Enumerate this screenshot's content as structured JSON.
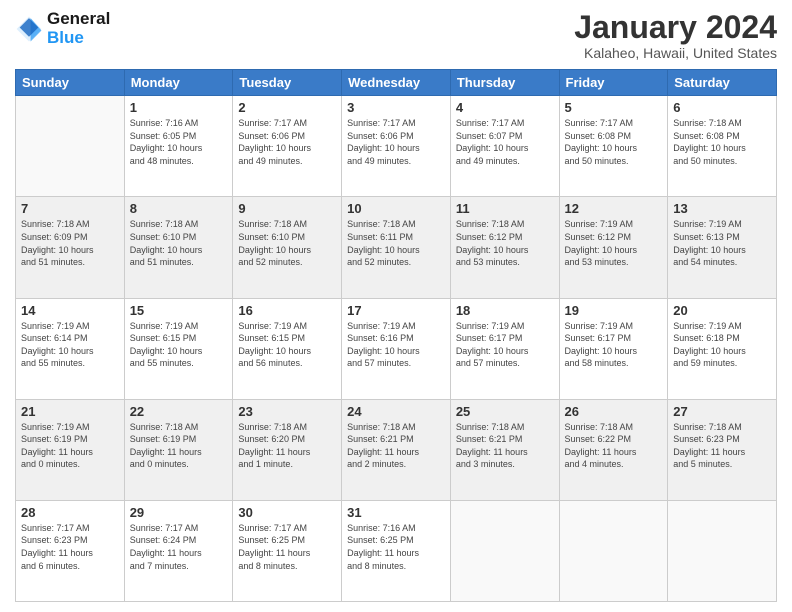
{
  "logo": {
    "line1": "General",
    "line2": "Blue"
  },
  "header": {
    "month": "January 2024",
    "location": "Kalaheo, Hawaii, United States"
  },
  "weekdays": [
    "Sunday",
    "Monday",
    "Tuesday",
    "Wednesday",
    "Thursday",
    "Friday",
    "Saturday"
  ],
  "weeks": [
    [
      {
        "day": "",
        "info": ""
      },
      {
        "day": "1",
        "info": "Sunrise: 7:16 AM\nSunset: 6:05 PM\nDaylight: 10 hours\nand 48 minutes."
      },
      {
        "day": "2",
        "info": "Sunrise: 7:17 AM\nSunset: 6:06 PM\nDaylight: 10 hours\nand 49 minutes."
      },
      {
        "day": "3",
        "info": "Sunrise: 7:17 AM\nSunset: 6:06 PM\nDaylight: 10 hours\nand 49 minutes."
      },
      {
        "day": "4",
        "info": "Sunrise: 7:17 AM\nSunset: 6:07 PM\nDaylight: 10 hours\nand 49 minutes."
      },
      {
        "day": "5",
        "info": "Sunrise: 7:17 AM\nSunset: 6:08 PM\nDaylight: 10 hours\nand 50 minutes."
      },
      {
        "day": "6",
        "info": "Sunrise: 7:18 AM\nSunset: 6:08 PM\nDaylight: 10 hours\nand 50 minutes."
      }
    ],
    [
      {
        "day": "7",
        "info": "Sunrise: 7:18 AM\nSunset: 6:09 PM\nDaylight: 10 hours\nand 51 minutes."
      },
      {
        "day": "8",
        "info": "Sunrise: 7:18 AM\nSunset: 6:10 PM\nDaylight: 10 hours\nand 51 minutes."
      },
      {
        "day": "9",
        "info": "Sunrise: 7:18 AM\nSunset: 6:10 PM\nDaylight: 10 hours\nand 52 minutes."
      },
      {
        "day": "10",
        "info": "Sunrise: 7:18 AM\nSunset: 6:11 PM\nDaylight: 10 hours\nand 52 minutes."
      },
      {
        "day": "11",
        "info": "Sunrise: 7:18 AM\nSunset: 6:12 PM\nDaylight: 10 hours\nand 53 minutes."
      },
      {
        "day": "12",
        "info": "Sunrise: 7:19 AM\nSunset: 6:12 PM\nDaylight: 10 hours\nand 53 minutes."
      },
      {
        "day": "13",
        "info": "Sunrise: 7:19 AM\nSunset: 6:13 PM\nDaylight: 10 hours\nand 54 minutes."
      }
    ],
    [
      {
        "day": "14",
        "info": "Sunrise: 7:19 AM\nSunset: 6:14 PM\nDaylight: 10 hours\nand 55 minutes."
      },
      {
        "day": "15",
        "info": "Sunrise: 7:19 AM\nSunset: 6:15 PM\nDaylight: 10 hours\nand 55 minutes."
      },
      {
        "day": "16",
        "info": "Sunrise: 7:19 AM\nSunset: 6:15 PM\nDaylight: 10 hours\nand 56 minutes."
      },
      {
        "day": "17",
        "info": "Sunrise: 7:19 AM\nSunset: 6:16 PM\nDaylight: 10 hours\nand 57 minutes."
      },
      {
        "day": "18",
        "info": "Sunrise: 7:19 AM\nSunset: 6:17 PM\nDaylight: 10 hours\nand 57 minutes."
      },
      {
        "day": "19",
        "info": "Sunrise: 7:19 AM\nSunset: 6:17 PM\nDaylight: 10 hours\nand 58 minutes."
      },
      {
        "day": "20",
        "info": "Sunrise: 7:19 AM\nSunset: 6:18 PM\nDaylight: 10 hours\nand 59 minutes."
      }
    ],
    [
      {
        "day": "21",
        "info": "Sunrise: 7:19 AM\nSunset: 6:19 PM\nDaylight: 11 hours\nand 0 minutes."
      },
      {
        "day": "22",
        "info": "Sunrise: 7:18 AM\nSunset: 6:19 PM\nDaylight: 11 hours\nand 0 minutes."
      },
      {
        "day": "23",
        "info": "Sunrise: 7:18 AM\nSunset: 6:20 PM\nDaylight: 11 hours\nand 1 minute."
      },
      {
        "day": "24",
        "info": "Sunrise: 7:18 AM\nSunset: 6:21 PM\nDaylight: 11 hours\nand 2 minutes."
      },
      {
        "day": "25",
        "info": "Sunrise: 7:18 AM\nSunset: 6:21 PM\nDaylight: 11 hours\nand 3 minutes."
      },
      {
        "day": "26",
        "info": "Sunrise: 7:18 AM\nSunset: 6:22 PM\nDaylight: 11 hours\nand 4 minutes."
      },
      {
        "day": "27",
        "info": "Sunrise: 7:18 AM\nSunset: 6:23 PM\nDaylight: 11 hours\nand 5 minutes."
      }
    ],
    [
      {
        "day": "28",
        "info": "Sunrise: 7:17 AM\nSunset: 6:23 PM\nDaylight: 11 hours\nand 6 minutes."
      },
      {
        "day": "29",
        "info": "Sunrise: 7:17 AM\nSunset: 6:24 PM\nDaylight: 11 hours\nand 7 minutes."
      },
      {
        "day": "30",
        "info": "Sunrise: 7:17 AM\nSunset: 6:25 PM\nDaylight: 11 hours\nand 8 minutes."
      },
      {
        "day": "31",
        "info": "Sunrise: 7:16 AM\nSunset: 6:25 PM\nDaylight: 11 hours\nand 8 minutes."
      },
      {
        "day": "",
        "info": ""
      },
      {
        "day": "",
        "info": ""
      },
      {
        "day": "",
        "info": ""
      }
    ]
  ]
}
